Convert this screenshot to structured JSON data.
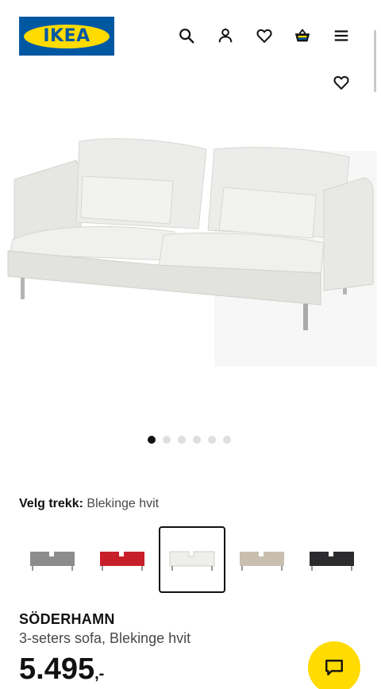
{
  "header": {
    "logo_text": "IKEA",
    "icons": [
      "search-icon",
      "user-icon",
      "heart-icon",
      "basket-icon",
      "menu-icon"
    ]
  },
  "gallery": {
    "image_description_icon": "sofa-image",
    "dots_count": 6,
    "active_dot": 1,
    "favourite_icon": "heart-icon"
  },
  "cover": {
    "label": "Velg trekk:",
    "value": "Blekinge hvit"
  },
  "swatches": [
    {
      "color": "#8c8c8c",
      "selected": false
    },
    {
      "color": "#c8202a",
      "selected": false
    },
    {
      "color": "#eeeeea",
      "selected": true
    },
    {
      "color": "#c9bfb0",
      "selected": false
    },
    {
      "color": "#2c2c2e",
      "selected": false
    }
  ],
  "product": {
    "name": "SÖDERHAMN",
    "description": "3-seters sofa, Blekinge hvit",
    "price": "5.495",
    "price_suffix": ",-"
  },
  "colors": {
    "brand_blue": "#0058a3",
    "brand_yellow": "#ffdb00"
  },
  "chat": {
    "icon": "chat-icon"
  }
}
